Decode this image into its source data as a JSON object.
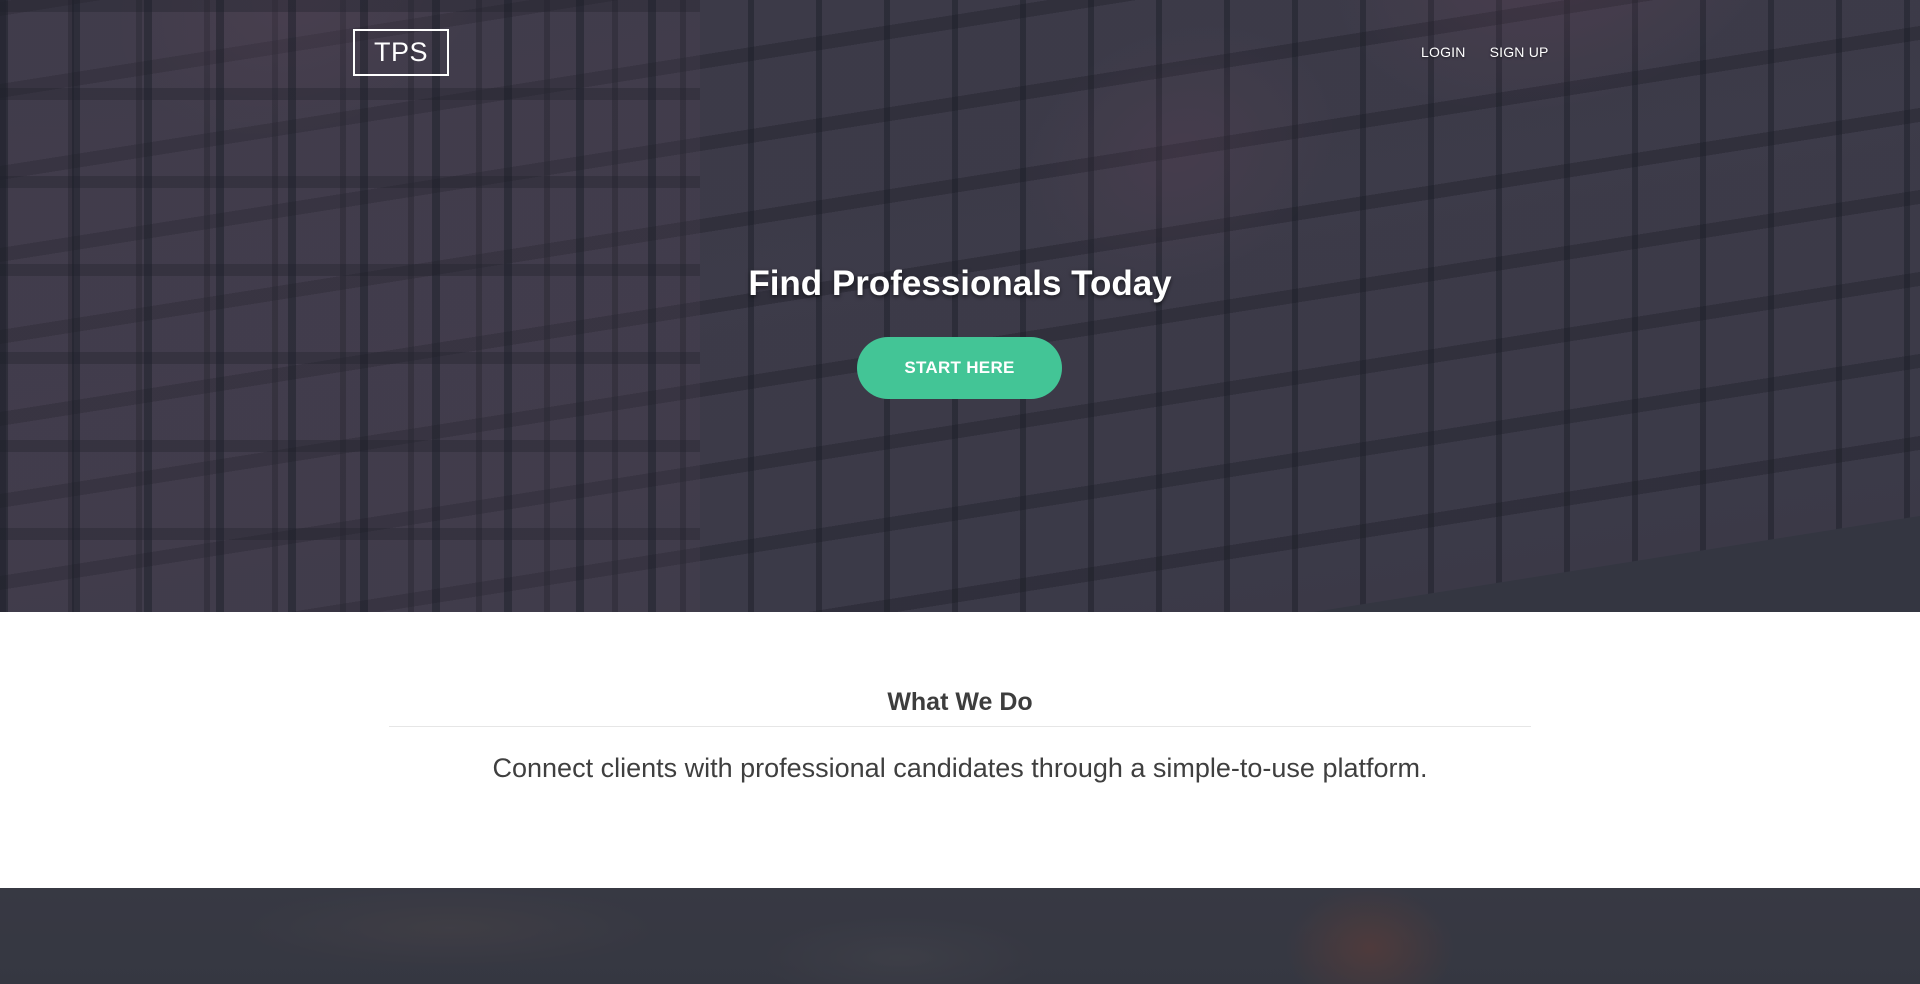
{
  "header": {
    "logo_text": "TPS",
    "nav": [
      {
        "label": "LOGIN"
      },
      {
        "label": "SIGN UP"
      }
    ]
  },
  "hero": {
    "title": "Find Professionals Today",
    "cta_label": "START HERE"
  },
  "about": {
    "title": "What We Do",
    "text": "Connect clients with professional candidates through a simple-to-use platform."
  },
  "colors": {
    "accent": "#43c596",
    "hero_overlay": "#30323e",
    "text_dark": "#3d3d3d"
  }
}
